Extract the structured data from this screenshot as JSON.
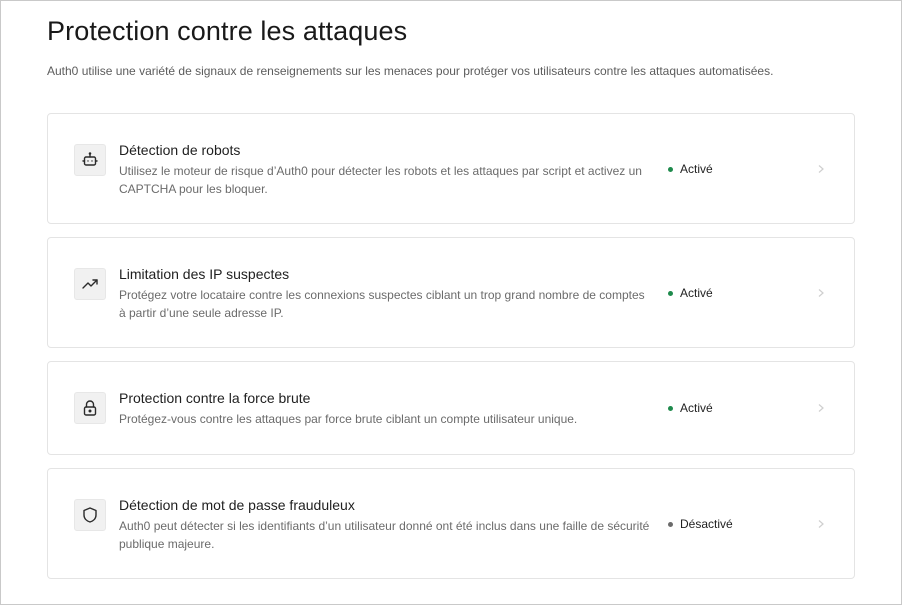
{
  "page": {
    "title": "Protection contre les attaques",
    "subtitle": "Auth0 utilise une variété de signaux de renseignements sur les menaces pour protéger vos utilisateurs contre les attaques automatisées."
  },
  "colors": {
    "active": "#1e8a4c",
    "inactive": "#6b6b6b"
  },
  "cards": [
    {
      "icon": "robot-icon",
      "title": "Détection de robots",
      "description": "Utilisez le moteur de risque d’Auth0 pour détecter les robots et les attaques par script et activez un CAPTCHA pour les bloquer.",
      "status": "Activé"
    },
    {
      "icon": "trending-up-icon",
      "title": "Limitation des IP suspectes",
      "description": "Protégez votre locataire contre les connexions suspectes ciblant un trop grand nombre de comptes à partir d’une seule adresse IP.",
      "status": "Activé"
    },
    {
      "icon": "lock-icon",
      "title": "Protection contre la force brute",
      "description": "Protégez-vous contre les attaques par force brute ciblant un compte utilisateur unique.",
      "status": "Activé"
    },
    {
      "icon": "shield-icon",
      "title": "Détection de mot de passe frauduleux",
      "description": "Auth0 peut détecter si les identifiants d’un utilisateur donné ont été inclus dans une faille de sécurité publique majeure.",
      "status": "Désactivé"
    }
  ]
}
